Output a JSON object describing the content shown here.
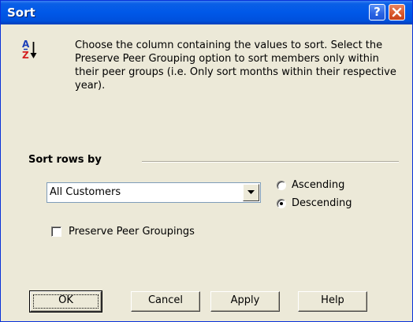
{
  "window": {
    "title": "Sort",
    "help_glyph": "?"
  },
  "instructions": "Choose the column containing the values to sort. Select the Preserve Peer Grouping option to sort members only within their peer groups (i.e. Only sort months within their respective year).",
  "sort_icon": {
    "letter_a": "A",
    "letter_z": "Z",
    "arrow": "↓"
  },
  "sort_section": {
    "label": "Sort rows by",
    "column_select": {
      "value": "All Customers"
    },
    "order_options": [
      {
        "label": "Ascending",
        "selected": false
      },
      {
        "label": "Descending",
        "selected": true
      }
    ],
    "preserve_peer": {
      "label": "Preserve Peer Groupings",
      "checked": false
    }
  },
  "buttons": {
    "ok": "OK",
    "cancel": "Cancel",
    "apply": "Apply",
    "help": "Help"
  }
}
